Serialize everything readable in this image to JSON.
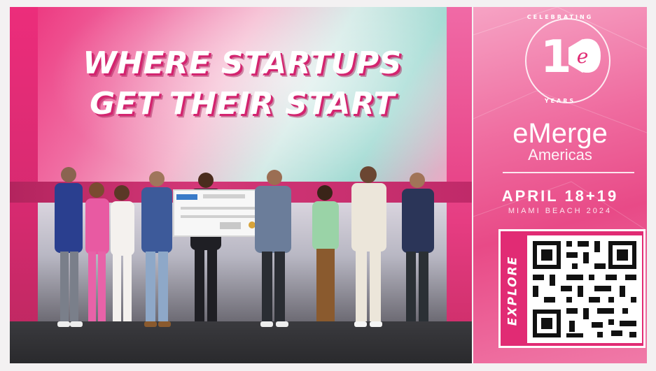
{
  "headline": {
    "line1": "WHERE STARTUPS",
    "line2": "GET THEIR START"
  },
  "badge": {
    "top_text": "CELEBRATING",
    "number": "10",
    "bottom_text": "YEARS"
  },
  "brand": {
    "name": "eMerge",
    "sub": "Americas"
  },
  "event": {
    "dates": "APRIL 18+19",
    "location": "MIAMI BEACH 2024"
  },
  "cta": {
    "label": "EXPLORE"
  },
  "colors": {
    "brand_pink": "#e12b74",
    "accent_teal": "#9ed9d1",
    "text_white": "#ffffff"
  },
  "icons": {
    "qr": "qr-code-icon",
    "logo_e": "hexagon-e-icon"
  }
}
